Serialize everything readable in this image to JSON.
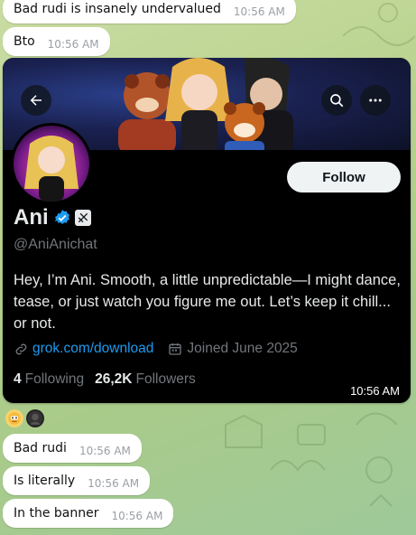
{
  "messages_top": [
    {
      "text": "Bad rudi is insanely undervalued",
      "time": "10:56 AM"
    },
    {
      "text": "Bto",
      "time": "10:56 AM"
    }
  ],
  "profile_card": {
    "display_name": "Ani",
    "handle": "@AniAnichat",
    "follow_label": "Follow",
    "bio": "Hey, I’m Ani. Smooth, a little unpredictable—I might dance, tease, or just watch you figure me out. Let’s keep it chill... or not.",
    "link": "grok.com/download",
    "joined": "Joined June 2025",
    "following_count": "4",
    "following_label": "Following",
    "followers_count": "26,2K",
    "followers_label": "Followers",
    "time": "10:56 AM",
    "icons": {
      "back": "back-arrow-icon",
      "search": "search-icon",
      "more": "more-icon",
      "verified": "verified-badge-icon",
      "affiliate": "affiliate-badge-icon",
      "link": "link-icon",
      "calendar": "calendar-icon"
    },
    "colors": {
      "link": "#1d9bf0",
      "verified": "#1d9bf0",
      "muted": "#71767b",
      "text": "#e7e9ea"
    }
  },
  "reactions": [
    "robot-emoji",
    "avatar"
  ],
  "messages_bottom": [
    {
      "text": "Bad rudi",
      "time": "10:56 AM"
    },
    {
      "text": "Is literally",
      "time": "10:56 AM"
    },
    {
      "text": "In the banner",
      "time": "10:56 AM"
    }
  ]
}
